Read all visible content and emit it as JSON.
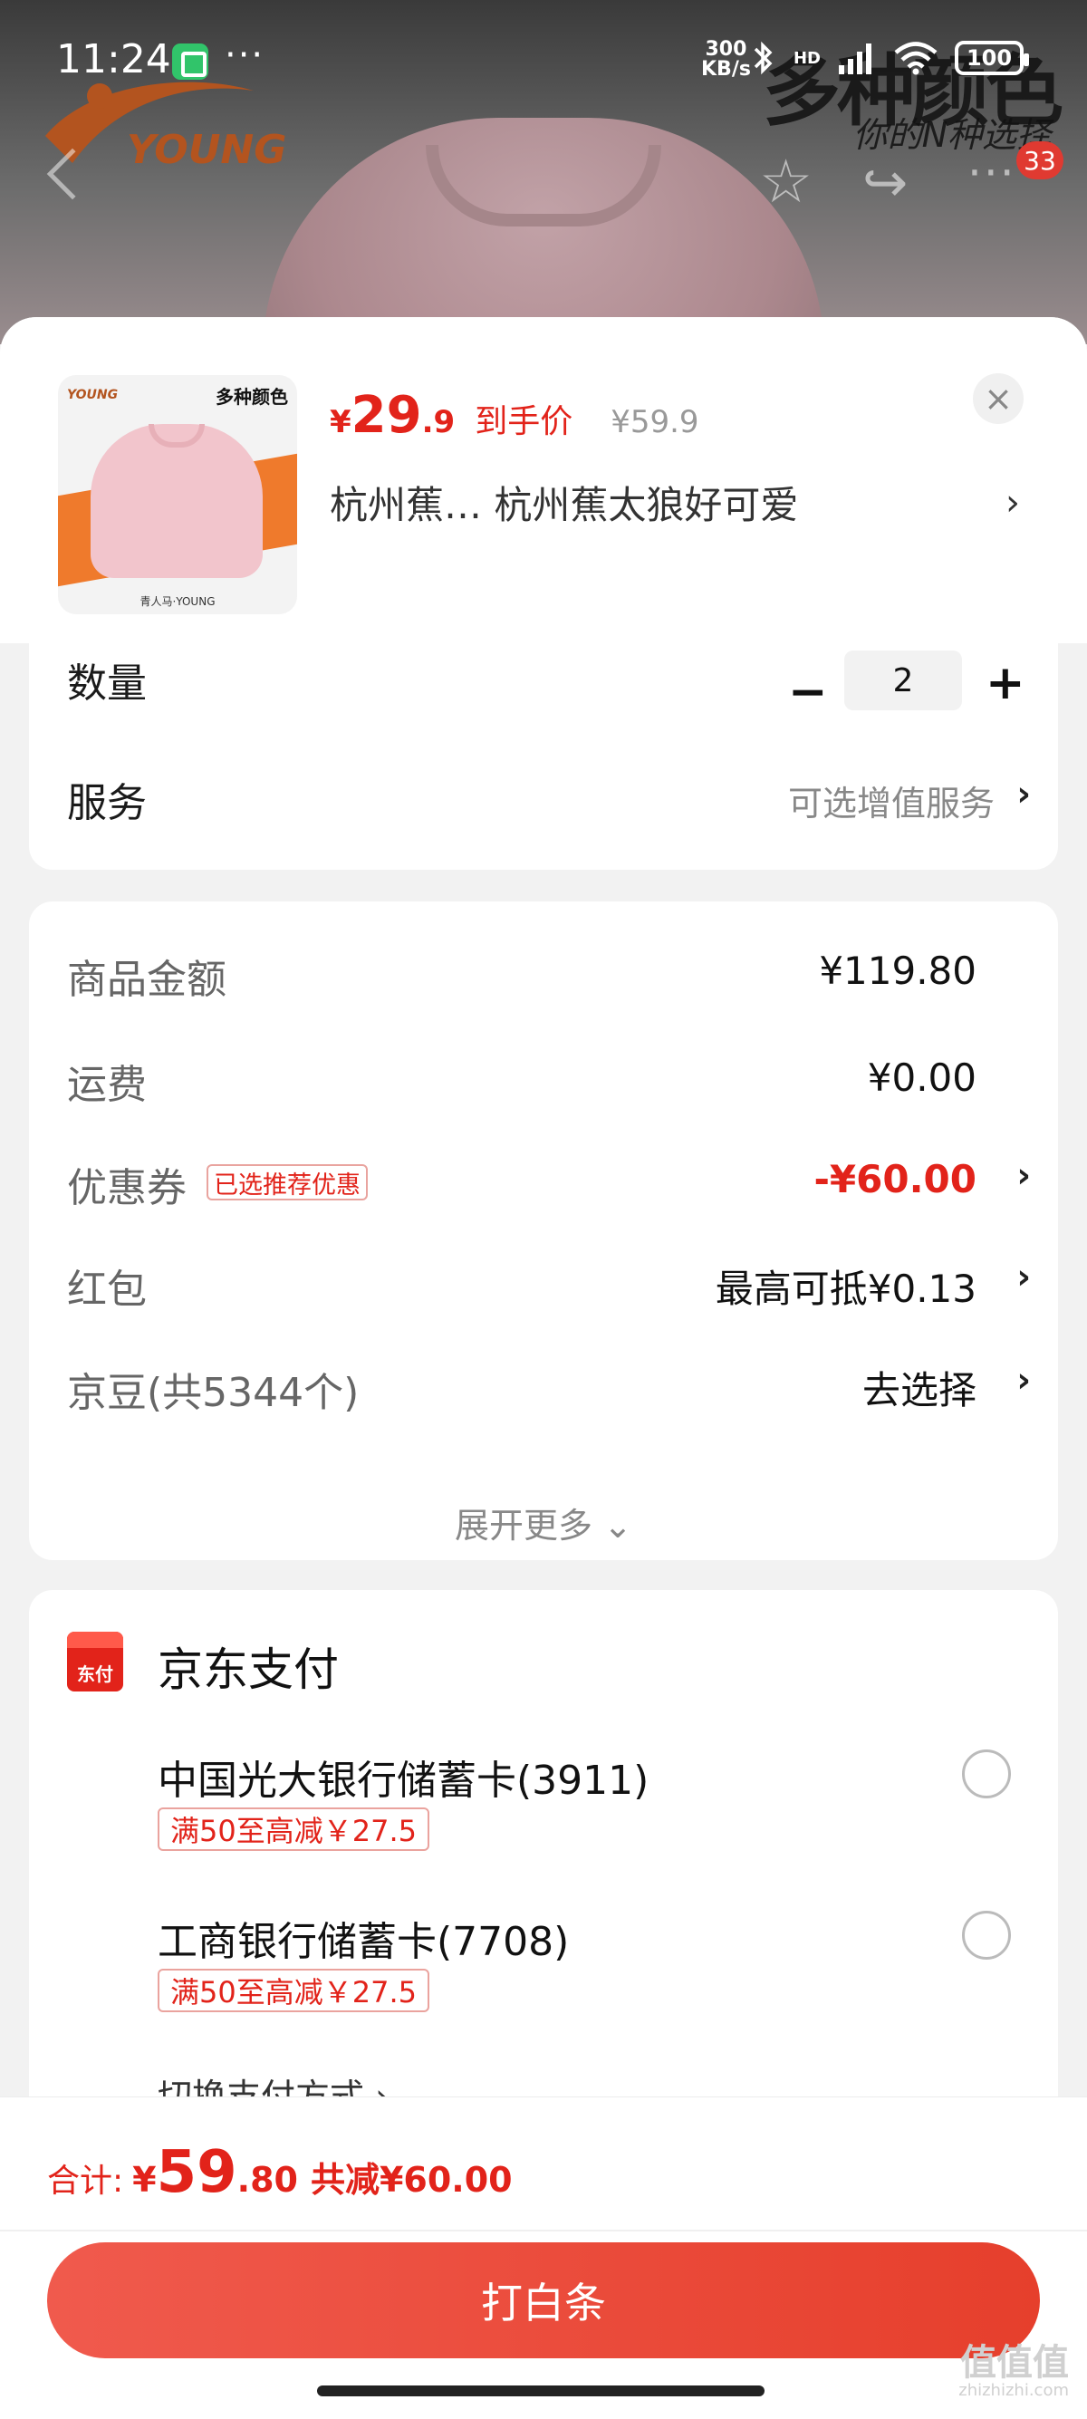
{
  "status_bar": {
    "time": "11:24",
    "more": "···",
    "net_speed_value": "300",
    "net_speed_unit": "KB/s",
    "signal_label": "HD",
    "battery": "100"
  },
  "background": {
    "brand_logo": "YOUNG",
    "promo_title": "多种颜色",
    "promo_subtitle": "你的N种选择"
  },
  "top_nav": {
    "back_icon": "chevron-left-icon",
    "favorite_icon": "star-icon",
    "share_icon": "share-icon",
    "more": "···",
    "badge_count": "33"
  },
  "product": {
    "thumbnail": {
      "title": "多种颜色",
      "logo": "YOUNG",
      "footer": "青人马·YOUNG"
    },
    "price_symbol": "¥",
    "price_int": "29",
    "price_dec": ".9",
    "price_tag": "到手价",
    "original_price": "¥59.9",
    "variant": "杭州蕉…  杭州蕉太狼好可爱",
    "close": "×",
    "chevron": "›"
  },
  "options": {
    "quantity_label": "数量",
    "quantity_value": "2",
    "minus": "−",
    "plus": "+",
    "service_label": "服务",
    "service_value": "可选增值服务",
    "chevron": "›"
  },
  "fees": {
    "items": [
      {
        "label": "商品金额",
        "value": "¥119.80"
      },
      {
        "label": "运费",
        "value": "¥0.00"
      },
      {
        "label": "优惠券",
        "badge": "已选推荐优惠",
        "value": "-¥60.00"
      },
      {
        "label": "红包",
        "value": "最高可抵¥0.13"
      },
      {
        "label": "京豆(共5344个)",
        "value": "去选择"
      }
    ],
    "chevron": "›",
    "expand_more": "展开更多 ⌄"
  },
  "payment": {
    "icon_text": "东付",
    "title": "京东支付",
    "methods": [
      {
        "name": "中国光大银行储蓄卡(3911)",
        "promo": "满50至高减￥27.5"
      },
      {
        "name": "工商银行储蓄卡(7708)",
        "promo": "满50至高减￥27.5"
      }
    ],
    "switch_label": "切换支付方式 ›"
  },
  "bottom": {
    "total_label": "合计:",
    "total_symbol": "¥",
    "total_int": "59",
    "total_dec": ".80",
    "total_saved": "共减¥60.00",
    "pay_button": "打白条"
  },
  "watermark": {
    "text": "值值值",
    "url": "zhizhizhi.com"
  },
  "colors": {
    "accent_red": "#e2231a",
    "button_red": "#e63f2c",
    "page_bg": "#f2f2f2"
  }
}
